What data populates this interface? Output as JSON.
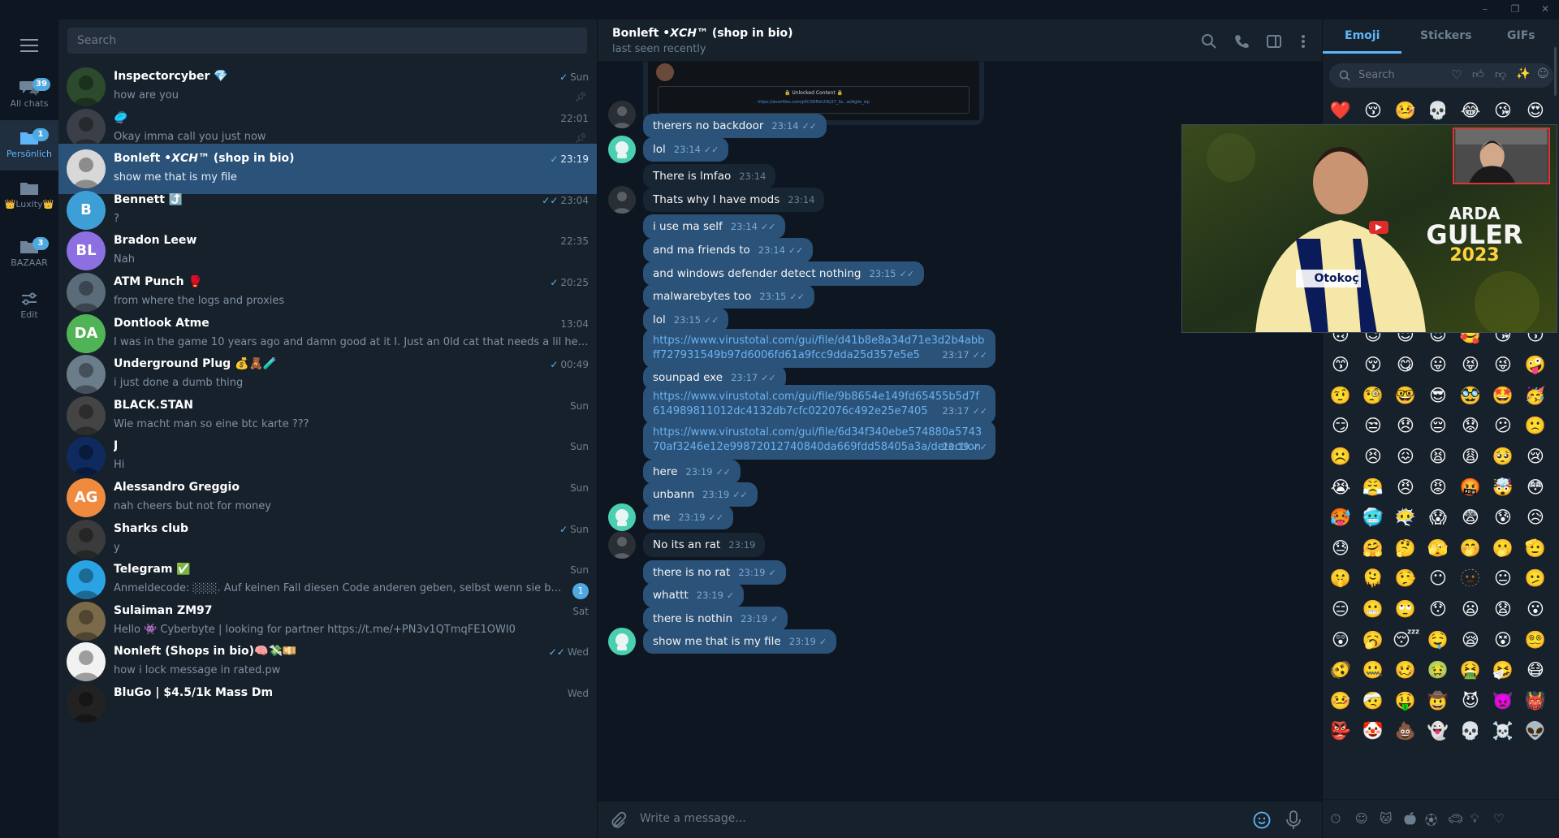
{
  "folders": [
    {
      "label": "All chats",
      "badge": "39",
      "icon": "chats-icon"
    },
    {
      "label": "Persönlich",
      "badge": "1",
      "icon": "folder-icon",
      "active": true
    },
    {
      "label": "👑Luxity👑",
      "badge": "",
      "icon": "folder-icon"
    },
    {
      "label": "BAZAAR",
      "badge": "3",
      "icon": "folder-icon"
    },
    {
      "label": "Edit",
      "badge": "",
      "icon": "edit-filters-icon"
    }
  ],
  "search": {
    "placeholder": "Search"
  },
  "chats": [
    {
      "name": "Inspectorcyber 💎",
      "preview": "how are you",
      "time": "Sun",
      "check": "✓",
      "pinned": true,
      "av_color": "#2c4a2e",
      "av_text": ""
    },
    {
      "name": "🥏",
      "preview": "Okay imma call you just now",
      "time": "22:01",
      "check": "",
      "pinned": true,
      "av_color": "#3b3f47",
      "av_text": ""
    },
    {
      "name": "Bonleft •𝙓𝘾𝙃™ (shop in bio)",
      "preview": "show me that is my file",
      "time": "23:19",
      "check": "✓",
      "active": true,
      "av_color": "#d8d8d8",
      "av_text": ""
    },
    {
      "name": "Bennett ⤴️",
      "preview": "?",
      "time": "23:04",
      "check": "✓✓",
      "av_color": "#3e9fd6",
      "av_text": "B"
    },
    {
      "name": "Bradon Leew",
      "preview": "Nah",
      "time": "22:35",
      "check": "",
      "av_color": "#8c6fe0",
      "av_text": "BL"
    },
    {
      "name": "ATM Punch 🥊",
      "preview": "from where the logs and proxies",
      "time": "20:25",
      "check": "✓",
      "av_color": "#5a6b7a",
      "av_text": ""
    },
    {
      "name": "Dontlook Atme",
      "preview": "I was in the game 10 years ago and damn good at it I. Just an 0ld cat that needs a lil help catching ...",
      "time": "13:04",
      "check": "",
      "av_color": "#50b356",
      "av_text": "DA"
    },
    {
      "name": "Underground Plug 💰🧸🧪",
      "preview": "i just done a dumb thing",
      "time": "00:49",
      "check": "✓",
      "av_color": "#6b7c8a",
      "av_text": ""
    },
    {
      "name": "BLACK.STAN",
      "preview": "Wie macht man so eine btc karte ???",
      "time": "Sun",
      "check": "",
      "av_color": "#444",
      "av_text": ""
    },
    {
      "name": "J",
      "preview": "Hi",
      "time": "Sun",
      "check": "",
      "av_color": "#0f2a5e",
      "av_text": ""
    },
    {
      "name": "Alessandro Greggio",
      "preview": "nah cheers but not for money",
      "time": "Sun",
      "check": "",
      "av_color": "#f08a3e",
      "av_text": "AG"
    },
    {
      "name": "Sharks club",
      "preview": "y",
      "time": "Sun",
      "check": "✓",
      "av_color": "#3b3b3b",
      "av_text": ""
    },
    {
      "name": "Telegram ✅",
      "preview": "Anmeldecode: ░░░. Auf keinen Fall diesen Code anderen geben, selbst wenn sie behaupten ...",
      "time": "Sun",
      "check": "",
      "unread": "1",
      "av_color": "#2aa3e4",
      "av_text": ""
    },
    {
      "name": "Sulaiman ZM97",
      "preview": "Hello 👾 Cyberbyte | looking for partner  https://t.me/+PN3v1QTmqFE1OWI0",
      "time": "Sat",
      "check": "",
      "av_color": "#7a6a4a",
      "av_text": ""
    },
    {
      "name": "Nonleft (Shops in bio)🧠💸💴",
      "preview": "how i lock message in rated.pw",
      "time": "Wed",
      "check": "✓✓",
      "av_color": "#f2f2f2",
      "av_text": ""
    },
    {
      "name": "BluGo | $4.5/1k Mass Dm",
      "preview": "",
      "time": "Wed",
      "check": "",
      "av_color": "#222",
      "av_text": ""
    }
  ],
  "chat_header": {
    "name": "Bonleft •𝙓𝘾𝙃™ (shop in bio)",
    "status": "last seen recently"
  },
  "preview_card": {
    "caption": "🔒 Unlocked Content 🔒",
    "link": "https://anonfiles.com/p5C0DFeh2t6/27_3s...w/Agile_zip"
  },
  "messages": [
    {
      "text": "therers no backdoor",
      "time": "23:14",
      "out": true,
      "check": "✓✓"
    },
    {
      "text": "lol",
      "time": "23:14",
      "out": true,
      "check": "✓✓"
    },
    {
      "text": "There is lmfao",
      "time": "23:14",
      "out": false,
      "check": ""
    },
    {
      "text": "Thats why I have mods",
      "time": "23:14",
      "out": false,
      "check": ""
    },
    {
      "text": "i use ma self",
      "time": "23:14",
      "out": true,
      "check": "✓✓"
    },
    {
      "text": "and ma friends to",
      "time": "23:14",
      "out": true,
      "check": "✓✓"
    },
    {
      "text": "and windows defender detect nothing",
      "time": "23:15",
      "out": true,
      "check": "✓✓"
    },
    {
      "text": "malwarebytes too",
      "time": "23:15",
      "out": true,
      "check": "✓✓"
    },
    {
      "text": "lol",
      "time": "23:15",
      "out": true,
      "check": "✓✓"
    },
    {
      "text": "https://www.virustotal.com/gui/file/d41b8e8a34d71e3d2b4abbff727931549b97d6006fd61a9fcc9dda25d357e5e5",
      "time": "23:17",
      "out": true,
      "check": "✓✓",
      "link": true
    },
    {
      "text": "sounpad exe",
      "time": "23:17",
      "out": true,
      "check": "✓✓"
    },
    {
      "text": "https://www.virustotal.com/gui/file/9b8654e149fd65455b5d7f614989811012dc4132db7cfc022076c492e25e7405",
      "time": "23:17",
      "out": true,
      "check": "✓✓",
      "link": true
    },
    {
      "text": "https://www.virustotal.com/gui/file/6d34f340ebe574880a574370af3246e12e99872012740840da669fdd58405a3a/detection",
      "time": "23:19",
      "out": true,
      "check": "✓✓",
      "link": true
    },
    {
      "text": "here",
      "time": "23:19",
      "out": true,
      "check": "✓✓"
    },
    {
      "text": "unbann",
      "time": "23:19",
      "out": true,
      "check": "✓✓"
    },
    {
      "text": "me",
      "time": "23:19",
      "out": true,
      "check": "✓✓"
    },
    {
      "text": "No its an rat",
      "time": "23:19",
      "out": false,
      "check": ""
    },
    {
      "text": "there is no rat",
      "time": "23:19",
      "out": true,
      "check": "✓"
    },
    {
      "text": "whattt",
      "time": "23:19",
      "out": true,
      "check": "✓"
    },
    {
      "text": "there is nothin",
      "time": "23:19",
      "out": true,
      "check": "✓"
    },
    {
      "text": "show me that is my file",
      "time": "23:19",
      "out": true,
      "check": "✓"
    }
  ],
  "composer": {
    "placeholder": "Write a message..."
  },
  "emoji_panel": {
    "tabs": [
      "Emoji",
      "Stickers",
      "GIFs"
    ],
    "search_placeholder": "Search",
    "recent": [
      "❤️",
      "😚",
      "🤒",
      "💀",
      "😂",
      "😘",
      "😍"
    ],
    "grid": [
      "😂",
      "🤣",
      "🥲",
      "☺️",
      "😊",
      "😇",
      "🙂",
      "🙃",
      "😉",
      "😌",
      "😍",
      "🥰",
      "😘",
      "😗",
      "😙",
      "😚",
      "😋",
      "😛",
      "😝",
      "😜",
      "🤪",
      "🤨",
      "🧐",
      "🤓",
      "😎",
      "🥸",
      "🤩",
      "🥳",
      "😏",
      "😒",
      "😞",
      "😔",
      "😟",
      "😕",
      "🙁",
      "☹️",
      "😣",
      "😖",
      "😫",
      "😩",
      "🥺",
      "😢",
      "😭",
      "😤",
      "😠",
      "😡",
      "🤬",
      "🤯",
      "😳",
      "🥵",
      "🥶",
      "😶‍🌫️",
      "😱",
      "😨",
      "😰",
      "😥",
      "😓",
      "🤗",
      "🤔",
      "🫣",
      "🤭",
      "🫢",
      "🫡",
      "🤫",
      "🫠",
      "🤥",
      "😶",
      "🫥",
      "😐",
      "🫤",
      "😑",
      "😬",
      "🙄",
      "😯",
      "😦",
      "😧",
      "😮",
      "😲",
      "🥱",
      "😴",
      "🤤",
      "😪",
      "😵",
      "😵‍💫",
      "🫨",
      "🤐",
      "🥴",
      "🤢",
      "🤮",
      "🤧",
      "😷",
      "🤒",
      "🤕",
      "🤑",
      "🤠",
      "😈",
      "👿",
      "👹",
      "👺",
      "🤡",
      "💩",
      "👻",
      "💀",
      "☠️",
      "👽"
    ],
    "video_overlay": {
      "title_line1": "ARDA",
      "title_line2": "GULER",
      "title_line3": "2023",
      "shirt_text": "Otokoç"
    }
  }
}
